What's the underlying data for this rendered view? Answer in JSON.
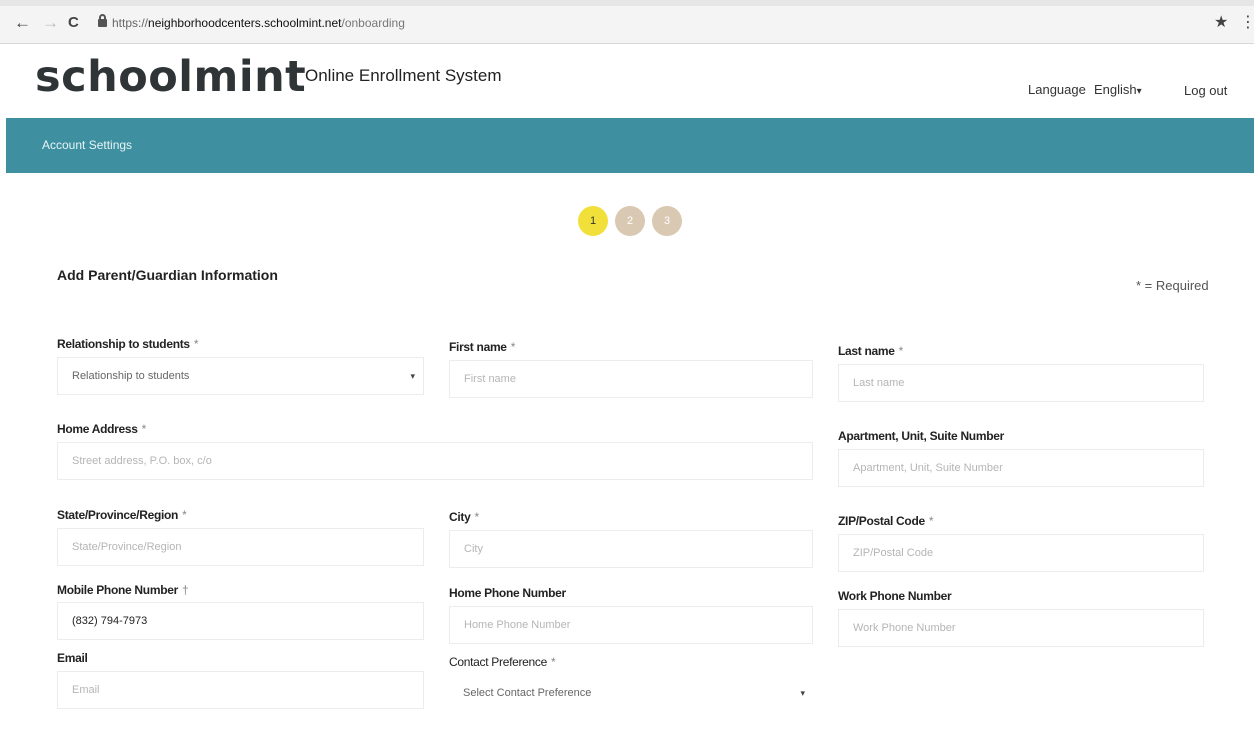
{
  "browser": {
    "back": "←",
    "forward": "→",
    "reload": "C",
    "url_scheme": "https://",
    "url_host": "neighborhoodcenters.schoolmint.net",
    "url_path": "/onboarding",
    "star": "★",
    "menu": "⋮"
  },
  "header": {
    "logo": "schoolmint",
    "system_title": "Online Enrollment System",
    "language_label": "Language",
    "language_value": "English",
    "language_caret": "▾",
    "logout": "Log out"
  },
  "banner": {
    "title": "Account Settings"
  },
  "steps": [
    "1",
    "2",
    "3"
  ],
  "section": {
    "title": "Add Parent/Guardian Information",
    "required_note": "* = Required"
  },
  "form": {
    "relationship": {
      "label": "Relationship to students",
      "req": "*",
      "value": "Relationship to students",
      "caret": "▾"
    },
    "first_name": {
      "label": "First name",
      "req": "*",
      "placeholder": "First name"
    },
    "last_name": {
      "label": "Last name",
      "req": "*",
      "placeholder": "Last name"
    },
    "home_address": {
      "label": "Home Address",
      "req": "*",
      "placeholder": "Street address, P.O. box, c/o"
    },
    "apartment": {
      "label": "Apartment, Unit, Suite Number",
      "placeholder": "Apartment, Unit, Suite Number"
    },
    "state": {
      "label": "State/Province/Region",
      "req": "*",
      "placeholder": "State/Province/Region"
    },
    "city": {
      "label": "City",
      "req": "*",
      "placeholder": "City"
    },
    "zip": {
      "label": "ZIP/Postal Code",
      "req": "*",
      "placeholder": "ZIP/Postal Code"
    },
    "mobile": {
      "label": "Mobile Phone Number",
      "req": "†",
      "value": "(832) 794-7973"
    },
    "home_phone": {
      "label": "Home Phone Number",
      "placeholder": "Home Phone Number"
    },
    "work_phone": {
      "label": "Work Phone Number",
      "placeholder": "Work Phone Number"
    },
    "email": {
      "label": "Email",
      "placeholder": "Email"
    },
    "contact_pref": {
      "label": "Contact Preference",
      "req": "*",
      "value": "Select Contact Preference",
      "caret": "▾"
    }
  }
}
